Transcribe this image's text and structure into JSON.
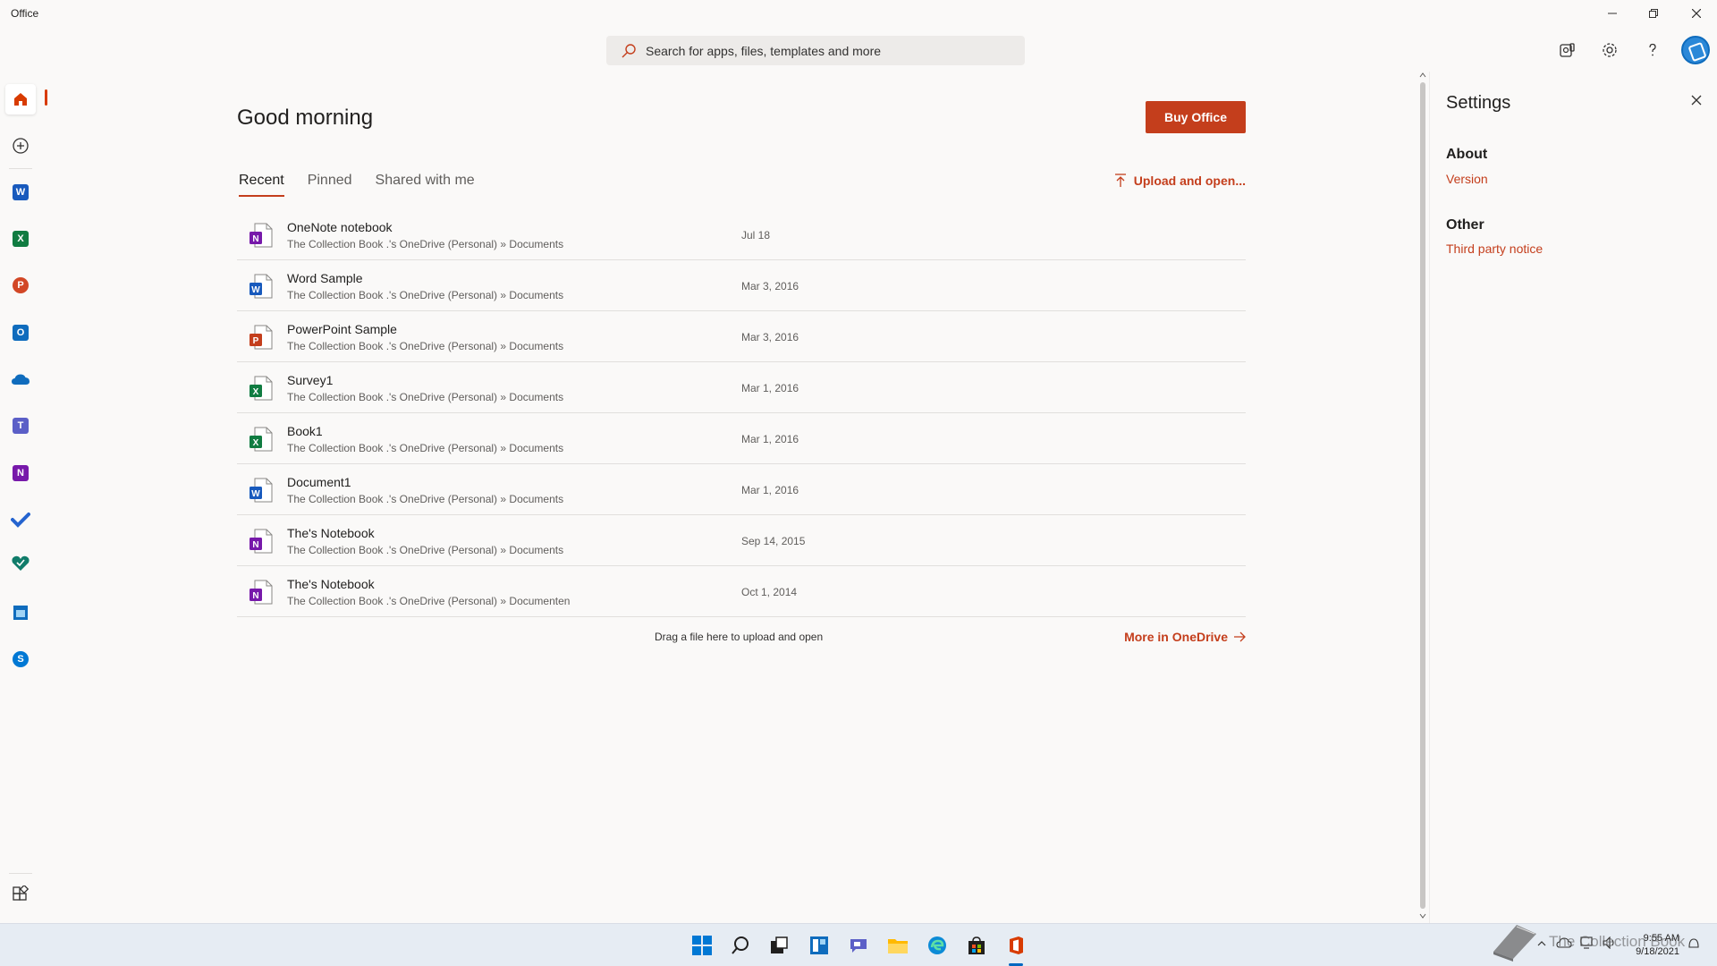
{
  "window": {
    "title": "Office"
  },
  "search": {
    "placeholder": "Search for apps, files, templates and more"
  },
  "main": {
    "greeting": "Good morning",
    "buy_label": "Buy Office",
    "tabs": [
      {
        "label": "Recent",
        "active": true
      },
      {
        "label": "Pinned",
        "active": false
      },
      {
        "label": "Shared with me",
        "active": false
      }
    ],
    "upload_label": "Upload and open...",
    "files": [
      {
        "name": "OneNote notebook",
        "path": "The Collection Book .'s OneDrive (Personal) » Documents",
        "date": "Jul 18",
        "type": "onenote"
      },
      {
        "name": "Word Sample",
        "path": "The Collection Book .'s OneDrive (Personal) » Documents",
        "date": "Mar 3, 2016",
        "type": "word"
      },
      {
        "name": "PowerPoint Sample",
        "path": "The Collection Book .'s OneDrive (Personal) » Documents",
        "date": "Mar 3, 2016",
        "type": "powerpoint"
      },
      {
        "name": "Survey1",
        "path": "The Collection Book .'s OneDrive (Personal) » Documents",
        "date": "Mar 1, 2016",
        "type": "excel"
      },
      {
        "name": "Book1",
        "path": "The Collection Book .'s OneDrive (Personal) » Documents",
        "date": "Mar 1, 2016",
        "type": "excel"
      },
      {
        "name": "Document1",
        "path": "The Collection Book .'s OneDrive (Personal) » Documents",
        "date": "Mar 1, 2016",
        "type": "word"
      },
      {
        "name": "The's Notebook",
        "path": "The Collection Book .'s OneDrive (Personal) » Documents",
        "date": "Sep 14, 2015",
        "type": "onenote"
      },
      {
        "name": "The's Notebook",
        "path": "The Collection Book .'s OneDrive (Personal) » Documenten",
        "date": "Oct 1, 2014",
        "type": "onenote"
      }
    ],
    "drag_hint": "Drag a file here to upload and open",
    "more_label": "More in OneDrive"
  },
  "settings": {
    "title": "Settings",
    "sections": [
      {
        "heading": "About",
        "link": "Version"
      },
      {
        "heading": "Other",
        "link": "Third party notice"
      }
    ]
  },
  "nav_icons": [
    "home-icon",
    "create-icon",
    "word-icon",
    "excel-icon",
    "powerpoint-icon",
    "outlook-icon",
    "onedrive-icon",
    "teams-icon",
    "onenote-icon",
    "todo-icon",
    "family-safety-icon",
    "calendar-icon",
    "skype-icon",
    "all-apps-icon"
  ],
  "taskbar": {
    "clock_time": "9:55 AM",
    "clock_date": "9/18/2021",
    "watermark": "The Collection Book"
  },
  "colors": {
    "accent": "#c43e1c",
    "word": "#185abd",
    "excel": "#107c41",
    "powerpoint": "#c43e1c",
    "onenote": "#7719aa",
    "outlook": "#0f6cbd"
  }
}
